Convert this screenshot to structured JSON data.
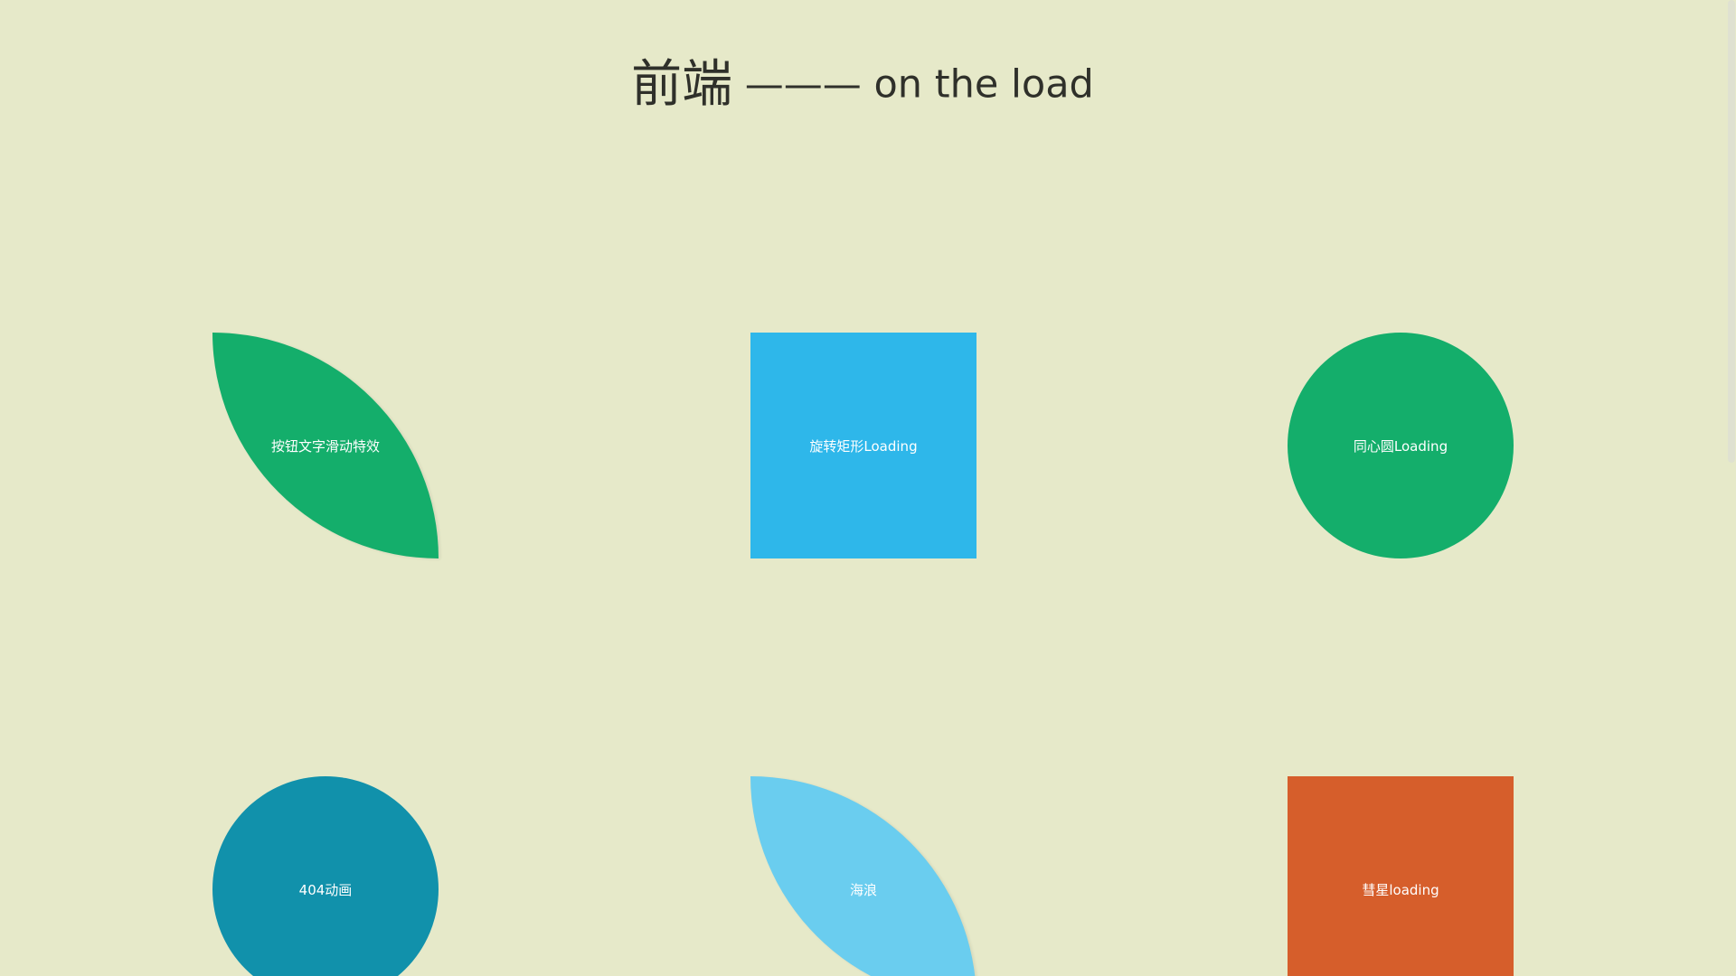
{
  "header": {
    "title_cn": "前端",
    "title_rest": " ——— on the load"
  },
  "cards": [
    {
      "label": "按钮文字滑动特效",
      "shape": "leaf",
      "color": "#14ae6b"
    },
    {
      "label": "旋转矩形Loading",
      "shape": "square",
      "color": "#2eb7ea"
    },
    {
      "label": "同心圆Loading",
      "shape": "circle",
      "color": "#14ae6b"
    },
    {
      "label": "404动画",
      "shape": "circle",
      "color": "#1191ab"
    },
    {
      "label": "海浪",
      "shape": "leaf",
      "color": "#6acdef"
    },
    {
      "label": "彗星loading",
      "shape": "square",
      "color": "#d65e2b"
    }
  ],
  "colors": {
    "page_background": "#e6e9c9",
    "title_text": "#2f302a",
    "card_text": "#ffffff"
  }
}
